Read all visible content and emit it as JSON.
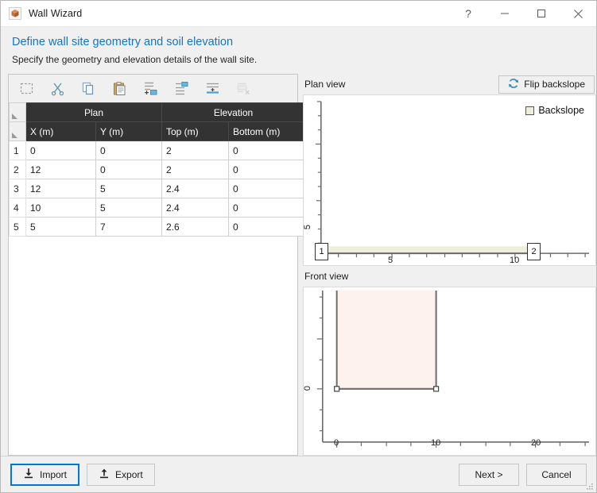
{
  "window": {
    "title": "Wall Wizard",
    "app_icon": "box-icon",
    "controls": {
      "help": "?",
      "minimize": "minimize-icon",
      "maximize": "maximize-icon",
      "close": "close-icon"
    }
  },
  "header": {
    "title": "Define wall site geometry and soil elevation",
    "subtitle": "Specify the geometry and elevation details of the wall site.",
    "title_color": "#1574c8"
  },
  "toolbar": {
    "items": [
      {
        "name": "select-all-icon",
        "enabled": true
      },
      {
        "name": "cut-icon",
        "enabled": true
      },
      {
        "name": "copy-icon",
        "enabled": true
      },
      {
        "name": "paste-icon",
        "enabled": true
      },
      {
        "name": "insert-row-above-icon",
        "enabled": true
      },
      {
        "name": "insert-row-below-icon",
        "enabled": true
      },
      {
        "name": "insert-row-icon",
        "enabled": true
      },
      {
        "name": "delete-row-icon",
        "enabled": false
      }
    ]
  },
  "table": {
    "group_headers": [
      {
        "label": "Plan",
        "span": 2
      },
      {
        "label": "Elevation",
        "span": 2
      }
    ],
    "columns": [
      "X (m)",
      "Y (m)",
      "Top (m)",
      "Bottom (m)"
    ],
    "rows": [
      {
        "num": "1",
        "cells": [
          "0",
          "0",
          "2",
          "0"
        ]
      },
      {
        "num": "2",
        "cells": [
          "12",
          "0",
          "2",
          "0"
        ]
      },
      {
        "num": "3",
        "cells": [
          "12",
          "5",
          "2.4",
          "0"
        ]
      },
      {
        "num": "4",
        "cells": [
          "10",
          "5",
          "2.4",
          "0"
        ]
      },
      {
        "num": "5",
        "cells": [
          "5",
          "7",
          "2.6",
          "0"
        ]
      }
    ]
  },
  "plan_view": {
    "title": "Plan view",
    "flip_button": "Flip backslope",
    "flip_icon": "refresh-icon",
    "legend": [
      {
        "label": "Backslope",
        "color": "#eeeedb"
      }
    ]
  },
  "front_view": {
    "title": "Front view"
  },
  "footer": {
    "import": "Import",
    "import_icon": "download-icon",
    "export": "Export",
    "export_icon": "upload-icon",
    "next": "Next >",
    "cancel": "Cancel",
    "grip": "resize-grip"
  },
  "chart_data": [
    {
      "type": "line",
      "title": "Plan view",
      "xlabel": "",
      "ylabel": "",
      "xlim": [
        -0.6,
        17.5
      ],
      "ylim": [
        -0.8,
        8.6
      ],
      "xticks": [
        5,
        10
      ],
      "xticklabels": [
        "5",
        "10"
      ],
      "yticks": [
        5
      ],
      "yticklabels": [
        "5"
      ],
      "grid": false,
      "legend": [
        "Backslope"
      ],
      "legend_position": "top-right",
      "annotations": [
        {
          "text": "1",
          "x": 0,
          "y": 0
        },
        {
          "text": "2",
          "x": 12,
          "y": 0
        }
      ],
      "series": [
        {
          "name": "Backslope",
          "type": "area",
          "color": "#eeeedb",
          "x": [
            0,
            12,
            12,
            0
          ],
          "y": [
            0,
            0,
            0.35,
            0.35
          ]
        },
        {
          "name": "Wall line",
          "type": "line",
          "color": "#6b6b6b",
          "x": [
            0,
            12
          ],
          "y": [
            0,
            0
          ]
        }
      ]
    },
    {
      "type": "line",
      "title": "Front view",
      "xlabel": "",
      "ylabel": "",
      "xlim": [
        -2.5,
        27
      ],
      "ylim": [
        -2.6,
        4.4
      ],
      "xticks": [
        0,
        10,
        20
      ],
      "xticklabels": [
        "0",
        "10",
        "20"
      ],
      "yticks": [
        0
      ],
      "yticklabels": [
        "0"
      ],
      "grid": false,
      "legend": [],
      "series": [
        {
          "name": "Wall face",
          "type": "area",
          "color": "#fdf2ee",
          "edgecolor": "#6b6b6b",
          "x": [
            0,
            10,
            10,
            0
          ],
          "y": [
            0,
            0,
            2.6,
            2.6
          ]
        },
        {
          "name": "Base nodes",
          "type": "scatter",
          "color": "#ffffff",
          "edgecolor": "#444444",
          "x": [
            0,
            10
          ],
          "y": [
            0,
            0
          ]
        }
      ]
    }
  ]
}
